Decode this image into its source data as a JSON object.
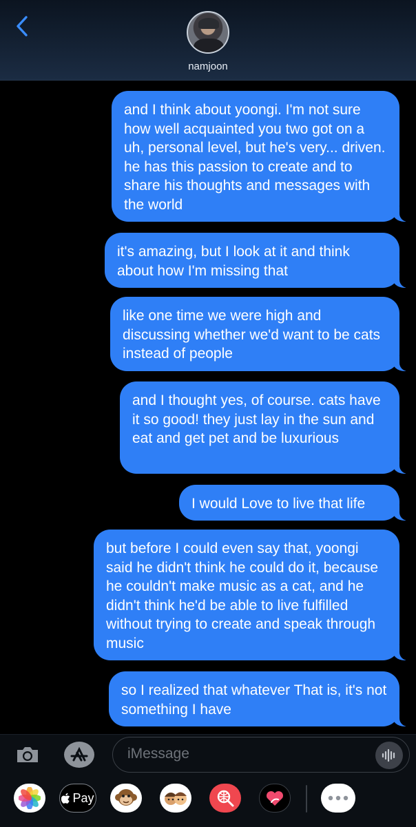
{
  "header": {
    "contact_name": "namjoon"
  },
  "messages": [
    "and I think about yoongi. I'm not sure how well acquainted you two got on a uh, personal level, but he's very... driven. he has this passion to create and to share his thoughts and messages with the world",
    "it's amazing, but I look at it and think about how I'm missing that",
    "like one time we were high and discussing whether we'd want to be cats instead of people",
    "and I thought yes, of course. cats have it so good! they just lay in the sun and eat and get pet and be luxurious",
    "I would Love to live that life",
    "but before I could even say that, yoongi said he didn't think he could do it, because he couldn't make music as a cat, and he didn't think he'd be able to live fulfilled without trying to create and speak through music",
    "so I realized that whatever That is, it's not something I have"
  ],
  "compose": {
    "placeholder": "iMessage"
  },
  "app_drawer": {
    "apple_pay_label": "Pay"
  },
  "colors": {
    "bubble": "#2f7ff6",
    "header_bg": "#1b2c43",
    "accent": "#3a8dff"
  }
}
